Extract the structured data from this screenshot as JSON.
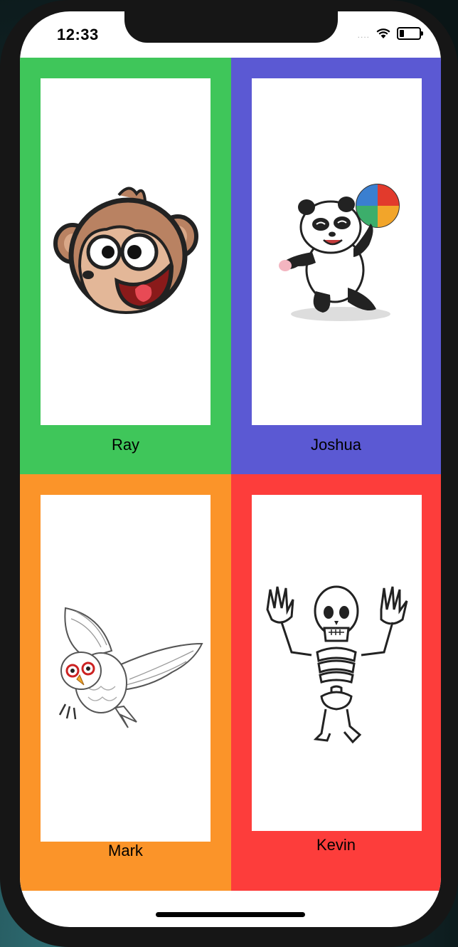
{
  "status_bar": {
    "time": "12:33",
    "signal": "....",
    "battery_level": 0.25
  },
  "cards": [
    {
      "name": "Ray",
      "background": "#3fc65a",
      "icon": "monkey-face-icon"
    },
    {
      "name": "Joshua",
      "background": "#5b59d3",
      "icon": "panda-with-beach-ball-icon"
    },
    {
      "name": "Mark",
      "background": "#fb9429",
      "icon": "owl-flying-icon"
    },
    {
      "name": "Kevin",
      "background": "#fd3d3b",
      "icon": "dancing-skeleton-icon"
    }
  ]
}
